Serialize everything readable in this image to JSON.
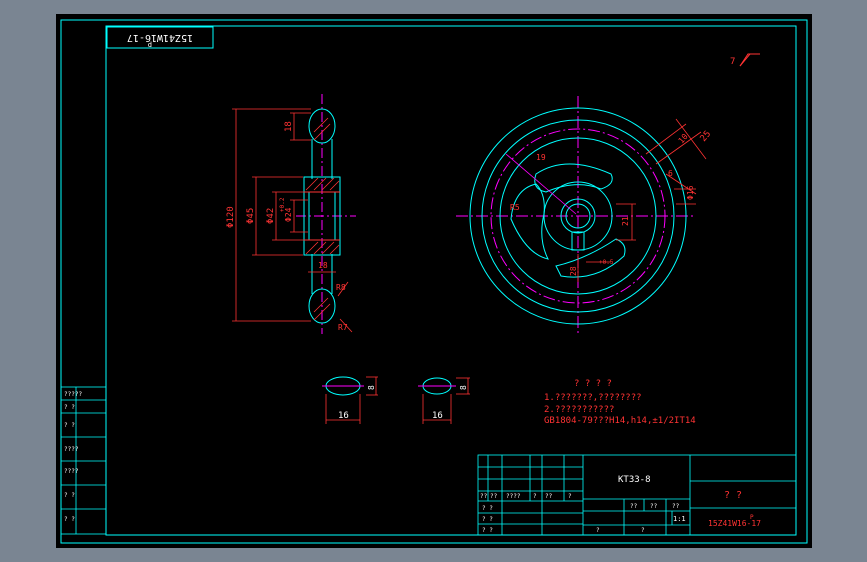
{
  "drawing": {
    "code_rotated": "15Z41W16-17",
    "code_rotated_sup": "p",
    "roughness_mark": "7",
    "dims": {
      "d120": "Φ120",
      "d45": "Φ45",
      "d42": "Φ42",
      "d24": "Φ24",
      "tol24": "+0.2",
      "top18": "18",
      "mid18": "18",
      "r8": "R8",
      "r7": "R7",
      "r25": "25",
      "r10": "10",
      "r16": "Φ16",
      "r19": "19",
      "r85": "R5",
      "r6": "6",
      "hub21": "21",
      "hub28": "28",
      "hub_tol": "+0.5",
      "sec16a": "16",
      "sec16b": "16",
      "sec8a": "8",
      "sec8b": "8"
    },
    "notes": {
      "heading": "? ? ? ?",
      "line1": "1.???????,????????",
      "line2": "2.???????????",
      "line3": "GB1804-79???H14,h14,±1/2IT14"
    },
    "side_table": [
      "?????",
      "?  ?",
      "?  ?",
      "????",
      "????",
      "?  ?",
      "?  ?"
    ],
    "title_block": {
      "material": "KT33-8",
      "name": "?  ?",
      "scale": "1:1",
      "drawing_no": "15Z41W16-17",
      "drawing_no_sup": "P",
      "qmarks": [
        "??",
        "??",
        "??",
        "?",
        "?"
      ],
      "rev_header": [
        "??",
        "??",
        "????",
        "?",
        "??",
        "?"
      ],
      "rev_rows": [
        "? ?",
        "? ?",
        "? ?"
      ]
    }
  }
}
